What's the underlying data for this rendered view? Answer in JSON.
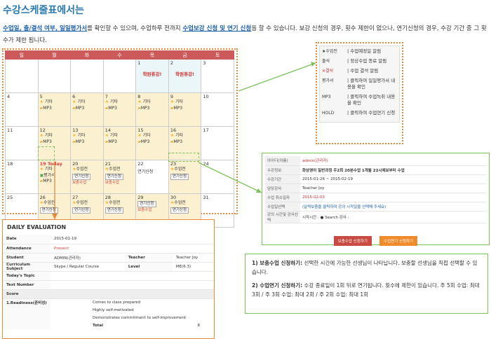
{
  "title": "수강스케줄표에서는",
  "intro": {
    "link1": "수업일, 출/결석 여부, 일일평가서",
    "text1": "를 확인할 수 있으며, 수업하루 전까지 ",
    "link2": "수업보강 신청 및 연기 신청",
    "text2": "을 할 수 있습니다. 보강 신청의 경우, 횟수 제한이 없으나, 연기신청의 경우, 수강 기간 중 그 횟수가 제한 됩니다."
  },
  "calendar": {
    "weekdays": [
      "일",
      "월",
      "화",
      "수",
      "목",
      "금",
      "토"
    ],
    "holiday_label": "학원휴강!",
    "today_label": "Today",
    "star_label": "기타",
    "folder_label": "MP3",
    "review_label": "평가서",
    "lesson_label": "수업전",
    "postpone_label": "연기신청",
    "makeup_label": "보충수업",
    "days": {
      "d1": "1",
      "d2": "2",
      "d3": "3",
      "d4": "4",
      "d5": "5",
      "d6": "6",
      "d7": "7",
      "d8": "8",
      "d9": "9",
      "d10": "10",
      "d11": "11",
      "d12": "12",
      "d13": "13",
      "d14": "14",
      "d15": "15",
      "d16": "16",
      "d17": "17",
      "d18": "18",
      "d19": "19",
      "d20": "20",
      "d21": "21",
      "d22": "22",
      "d23": "23",
      "d24": "24",
      "d25": "25",
      "d26": "26",
      "d27": "27",
      "d28": "28",
      "d29": "29",
      "d30": "30",
      "d31": "31"
    }
  },
  "legend": [
    {
      "key": "★수업전",
      "desc": "| 수업예정일 알림"
    },
    {
      "key": "출석",
      "desc": "| 정상수업 종료 알림"
    },
    {
      "key": "✕결석",
      "desc": "| 수업 결석 알림"
    },
    {
      "key": "평가서",
      "desc": "| 클릭하여 일일평가서 내용을 확인"
    },
    {
      "key": "MP3",
      "desc": "| 클릭하여 수업녹취 내용을 확인"
    },
    {
      "key": "HOLD",
      "desc": "| 클릭하여 수업연기 신청"
    }
  ],
  "info": {
    "rows": [
      {
        "h": "아이디(이름)",
        "v": "admin(관리자)"
      },
      {
        "h": "수강정보",
        "v": "화상영어 일반과정 주2회 20분수업 1개월 22시에보부터 수업"
      },
      {
        "h": "수강기간",
        "v": "2015-01-26 ~ 2015-02-19"
      },
      {
        "h": "담당강사",
        "v": "Teacher Joy"
      },
      {
        "h": "수업 취소일자",
        "v": "2015-02-03"
      },
      {
        "h": "수업일선택",
        "v": "(달력보충을 클릭하여 강의 시작일을 선택해 주세요)"
      },
      {
        "h": "강의 시간및 강사선택",
        "v": "시작시간 :          ● Search    강사 :"
      }
    ],
    "btn_makeup": "보충수업 신청하기",
    "btn_postpone": "수업연기 신청하기"
  },
  "eval": {
    "title": "DAILY EVALUATION",
    "date_h": "Date",
    "date_v": "2015-01-19",
    "att_h": "Attendance",
    "att_v": "Present",
    "student_h": "Student",
    "student_v": "ADMIN(관리자)",
    "teacher_h": "Teacher",
    "teacher_v": "Teacher Joy",
    "subject_h": "Curriculum Subject",
    "subject_v": "Skype / Regular Course",
    "level_h": "Level",
    "level_v": "ME(6.3)",
    "topic_h": "Today's Topic",
    "textnum_h": "Text Number",
    "score_h": "Score",
    "readiness_h": "1.Readiness(준비성)",
    "items": [
      "Comes to class prepared",
      "Highly self-motivated",
      "Demonstrates commitment to self-improvement"
    ],
    "total_h": "Total",
    "total_v": "8"
  },
  "notes": {
    "n1_label": "1) 보충수업 신청하기:",
    "n1_text": " 선택한 시간에 가능한 선생님이 나타납니다. 보충할 선생님을 직접 선택할 수 있습니다.",
    "n2_label": "2) 수업연기 신청하기:",
    "n2_text": " 수강 종료일이 1회 뒤로 연기됩니다. 횟수에 제한이 있습니다. 주 5회 수업: 최대 3회 / 주 3회 수업: 최대 2회 / 주 2회 수업: 최대 1회"
  },
  "colors": {
    "accent": "#2a7ab0",
    "weekday_header": "#cc5a5a",
    "frame_orange": "#e8893a",
    "frame_green": "#7bc25a"
  }
}
